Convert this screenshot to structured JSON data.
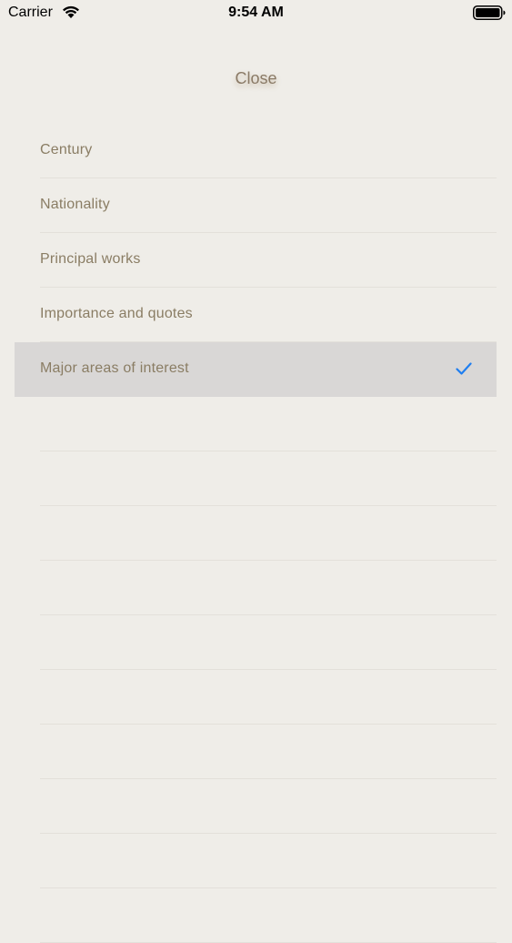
{
  "status_bar": {
    "carrier": "Carrier",
    "time": "9:54 AM",
    "wifi_icon": "wifi-icon",
    "battery_icon": "battery-icon"
  },
  "header": {
    "close_label": "Close"
  },
  "list": {
    "items": [
      {
        "label": "Century",
        "selected": false
      },
      {
        "label": "Nationality",
        "selected": false
      },
      {
        "label": "Principal works",
        "selected": false
      },
      {
        "label": "Importance and quotes",
        "selected": false
      },
      {
        "label": "Major areas of interest",
        "selected": true
      }
    ],
    "check_icon": "checkmark-icon"
  },
  "colors": {
    "background": "#efede8",
    "label_text": "#8a7d64",
    "selected_row": "#d9d7d6",
    "checkmark": "#1f7ef0",
    "separator": "#e3e0da"
  }
}
